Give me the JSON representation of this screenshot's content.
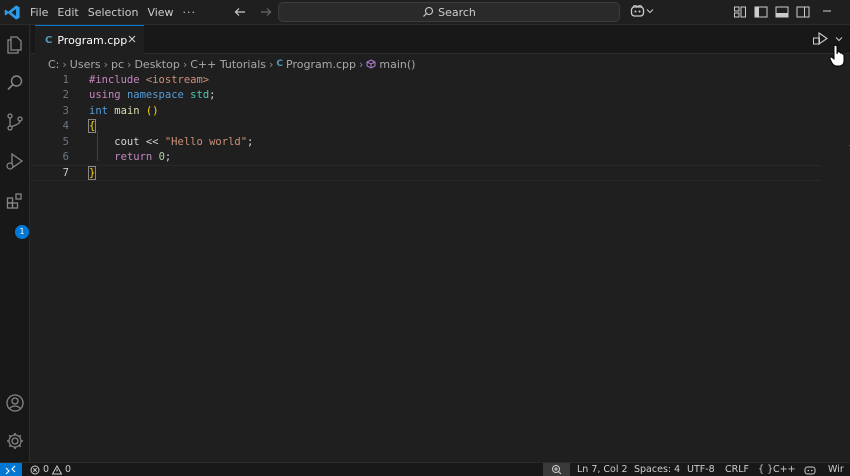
{
  "menu": [
    "File",
    "Edit",
    "Selection",
    "View",
    "···"
  ],
  "search": {
    "label": "Search"
  },
  "tab": {
    "filename": "Program.cpp",
    "lang_icon": "C"
  },
  "breadcrumb": [
    "C:",
    "Users",
    "pc",
    "Desktop",
    "C++ Tutorials",
    "Program.cpp",
    "main()"
  ],
  "breadcrumb_cpp_icon": "C",
  "editor": {
    "line_numbers": [
      "1",
      "2",
      "3",
      "4",
      "5",
      "6",
      "7"
    ],
    "active_line": 7,
    "lines": [
      [
        {
          "t": "#include ",
          "c": "kw-purple"
        },
        {
          "t": "<iostream>",
          "c": "str"
        }
      ],
      [
        {
          "t": "using",
          "c": "kw-purple"
        },
        {
          "t": " ",
          "c": "plain"
        },
        {
          "t": "namespace",
          "c": "kw-blue"
        },
        {
          "t": " ",
          "c": "plain"
        },
        {
          "t": "std",
          "c": "ns"
        },
        {
          "t": ";",
          "c": "plain"
        }
      ],
      [
        {
          "t": "int",
          "c": "kw-blue"
        },
        {
          "t": " ",
          "c": "plain"
        },
        {
          "t": "main",
          "c": "fn"
        },
        {
          "t": " ()",
          "c": "brace"
        }
      ],
      [
        {
          "t": "{",
          "c": "brace"
        }
      ],
      [
        {
          "t": "    cout << ",
          "c": "plain"
        },
        {
          "t": "\"Hello world\"",
          "c": "str"
        },
        {
          "t": ";",
          "c": "plain"
        }
      ],
      [
        {
          "t": "    ",
          "c": "plain"
        },
        {
          "t": "return",
          "c": "kw-purple"
        },
        {
          "t": " ",
          "c": "plain"
        },
        {
          "t": "0",
          "c": "num-lit"
        },
        {
          "t": ";",
          "c": "plain"
        }
      ],
      [
        {
          "t": "}",
          "c": "brace"
        }
      ]
    ]
  },
  "activity": {
    "extensions_badge": "1"
  },
  "status": {
    "errors": "0",
    "warnings": "0",
    "position": "Ln 7, Col 2",
    "spaces": "Spaces: 4",
    "encoding": "UTF-8",
    "eol": "CRLF",
    "language": "C++",
    "language_braces": "{ }",
    "trailing": "Wir"
  },
  "colors": {
    "accent": "#0078d4",
    "background": "#1f1f1f",
    "sidebar": "#181818"
  }
}
